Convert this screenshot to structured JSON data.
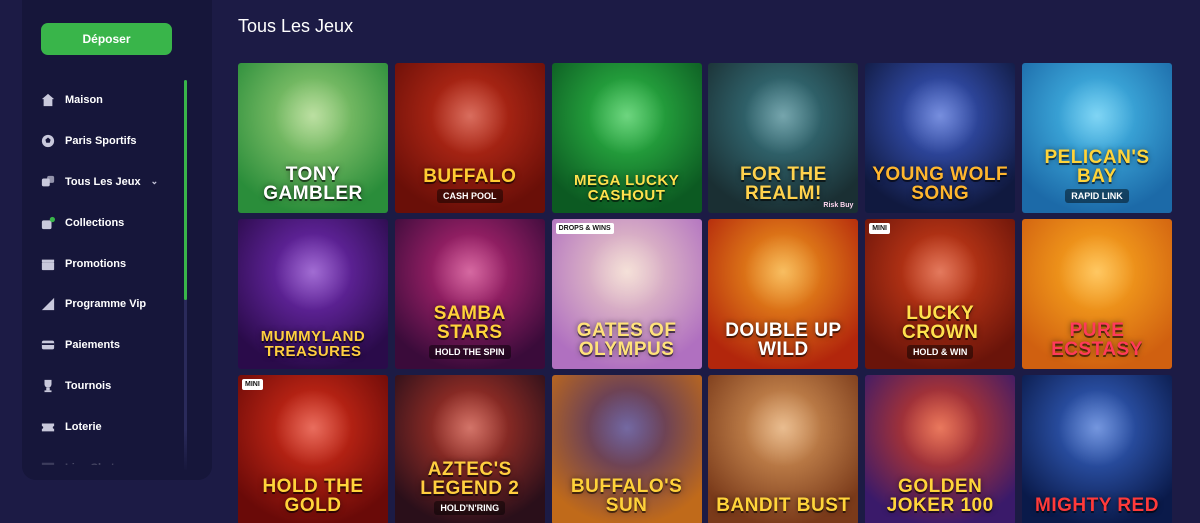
{
  "sidebar": {
    "deposit_label": "Déposer",
    "items": [
      {
        "label": "Maison",
        "icon": "home-icon"
      },
      {
        "label": "Paris Sportifs",
        "icon": "soccer-ball-icon"
      },
      {
        "label": "Tous Les Jeux",
        "icon": "dice-icon",
        "expandable": true
      },
      {
        "label": "Collections",
        "icon": "collections-icon"
      },
      {
        "label": "Promotions",
        "icon": "gift-icon"
      },
      {
        "label": "Programme Vip",
        "icon": "vip-icon"
      },
      {
        "label": "Paiements",
        "icon": "card-icon"
      },
      {
        "label": "Tournois",
        "icon": "trophy-icon"
      },
      {
        "label": "Loterie",
        "icon": "ticket-icon"
      },
      {
        "label": "Live Chat",
        "icon": "chat-icon"
      }
    ]
  },
  "main": {
    "section_title": "Tous Les Jeux",
    "games": [
      {
        "title": "Tony Gambler",
        "sub": "",
        "bg1": "#9fd27a",
        "bg2": "#2a8d3a",
        "color": "#ffffff"
      },
      {
        "title": "Buffalo",
        "sub": "Cash Pool",
        "bg1": "#c9301a",
        "bg2": "#6a0f08",
        "color": "#ffcc33"
      },
      {
        "title": "Mega Lucky Cashout",
        "sub": "",
        "bg1": "#31c44a",
        "bg2": "#0c5a22",
        "color": "#ffe14d"
      },
      {
        "title": "For The Realm!",
        "sub": "",
        "bg1": "#3c7f8a",
        "bg2": "#1a2f33",
        "color": "#ffd24d",
        "corner": "Risk Buy"
      },
      {
        "title": "Young Wolf Song",
        "sub": "",
        "bg1": "#3e5fd0",
        "bg2": "#10193f",
        "color": "#ffb62e"
      },
      {
        "title": "Pelican's Bay",
        "sub": "Rapid Link",
        "bg1": "#4ac3f0",
        "bg2": "#1c6aa8",
        "color": "#ffd43a"
      },
      {
        "title": "Mummyland Treasures",
        "sub": "",
        "bg1": "#7a2fc0",
        "bg2": "#2a0b4a",
        "color": "#ffcf3f"
      },
      {
        "title": "Samba Stars",
        "sub": "Hold The Spin",
        "bg1": "#c42a7a",
        "bg2": "#3a0b3a",
        "color": "#ffd23a"
      },
      {
        "title": "Gates of Olympus",
        "sub": "",
        "bg1": "#f0d3c8",
        "bg2": "#b070c0",
        "color": "#ffe27a",
        "badge": "DROPS & WINS"
      },
      {
        "title": "Double Up Wild",
        "sub": "",
        "bg1": "#f5a21e",
        "bg2": "#b2260c",
        "color": "#ffffff"
      },
      {
        "title": "Lucky Crown",
        "sub": "Hold & Win",
        "bg1": "#d8421a",
        "bg2": "#6a140a",
        "color": "#ffe14d",
        "badge": "MINI"
      },
      {
        "title": "Pure Ecstasy",
        "sub": "",
        "bg1": "#ffb020",
        "bg2": "#d06010",
        "color": "#ff3a5a"
      },
      {
        "title": "Hold The Gold",
        "sub": "",
        "bg1": "#e0301a",
        "bg2": "#6a0a08",
        "color": "#ffd43a",
        "badge": "MINI"
      },
      {
        "title": "Aztec's Legend 2",
        "sub": "Hold'N'Ring",
        "bg1": "#c03a2a",
        "bg2": "#2a0f1a",
        "color": "#ffcf3f"
      },
      {
        "title": "Buffalo's Sun",
        "sub": "",
        "bg1": "#3a2a7a",
        "bg2": "#c06a1a",
        "color": "#ffd23a"
      },
      {
        "title": "Bandit Bust",
        "sub": "",
        "bg1": "#e0a060",
        "bg2": "#7a3a1a",
        "color": "#ffd43a"
      },
      {
        "title": "Golden Joker 100",
        "sub": "",
        "bg1": "#e0401a",
        "bg2": "#3a1a6a",
        "color": "#ffd43a"
      },
      {
        "title": "Mighty Red",
        "sub": "",
        "bg1": "#3a6ad0",
        "bg2": "#0a1a4a",
        "color": "#ff3a3a"
      }
    ]
  }
}
